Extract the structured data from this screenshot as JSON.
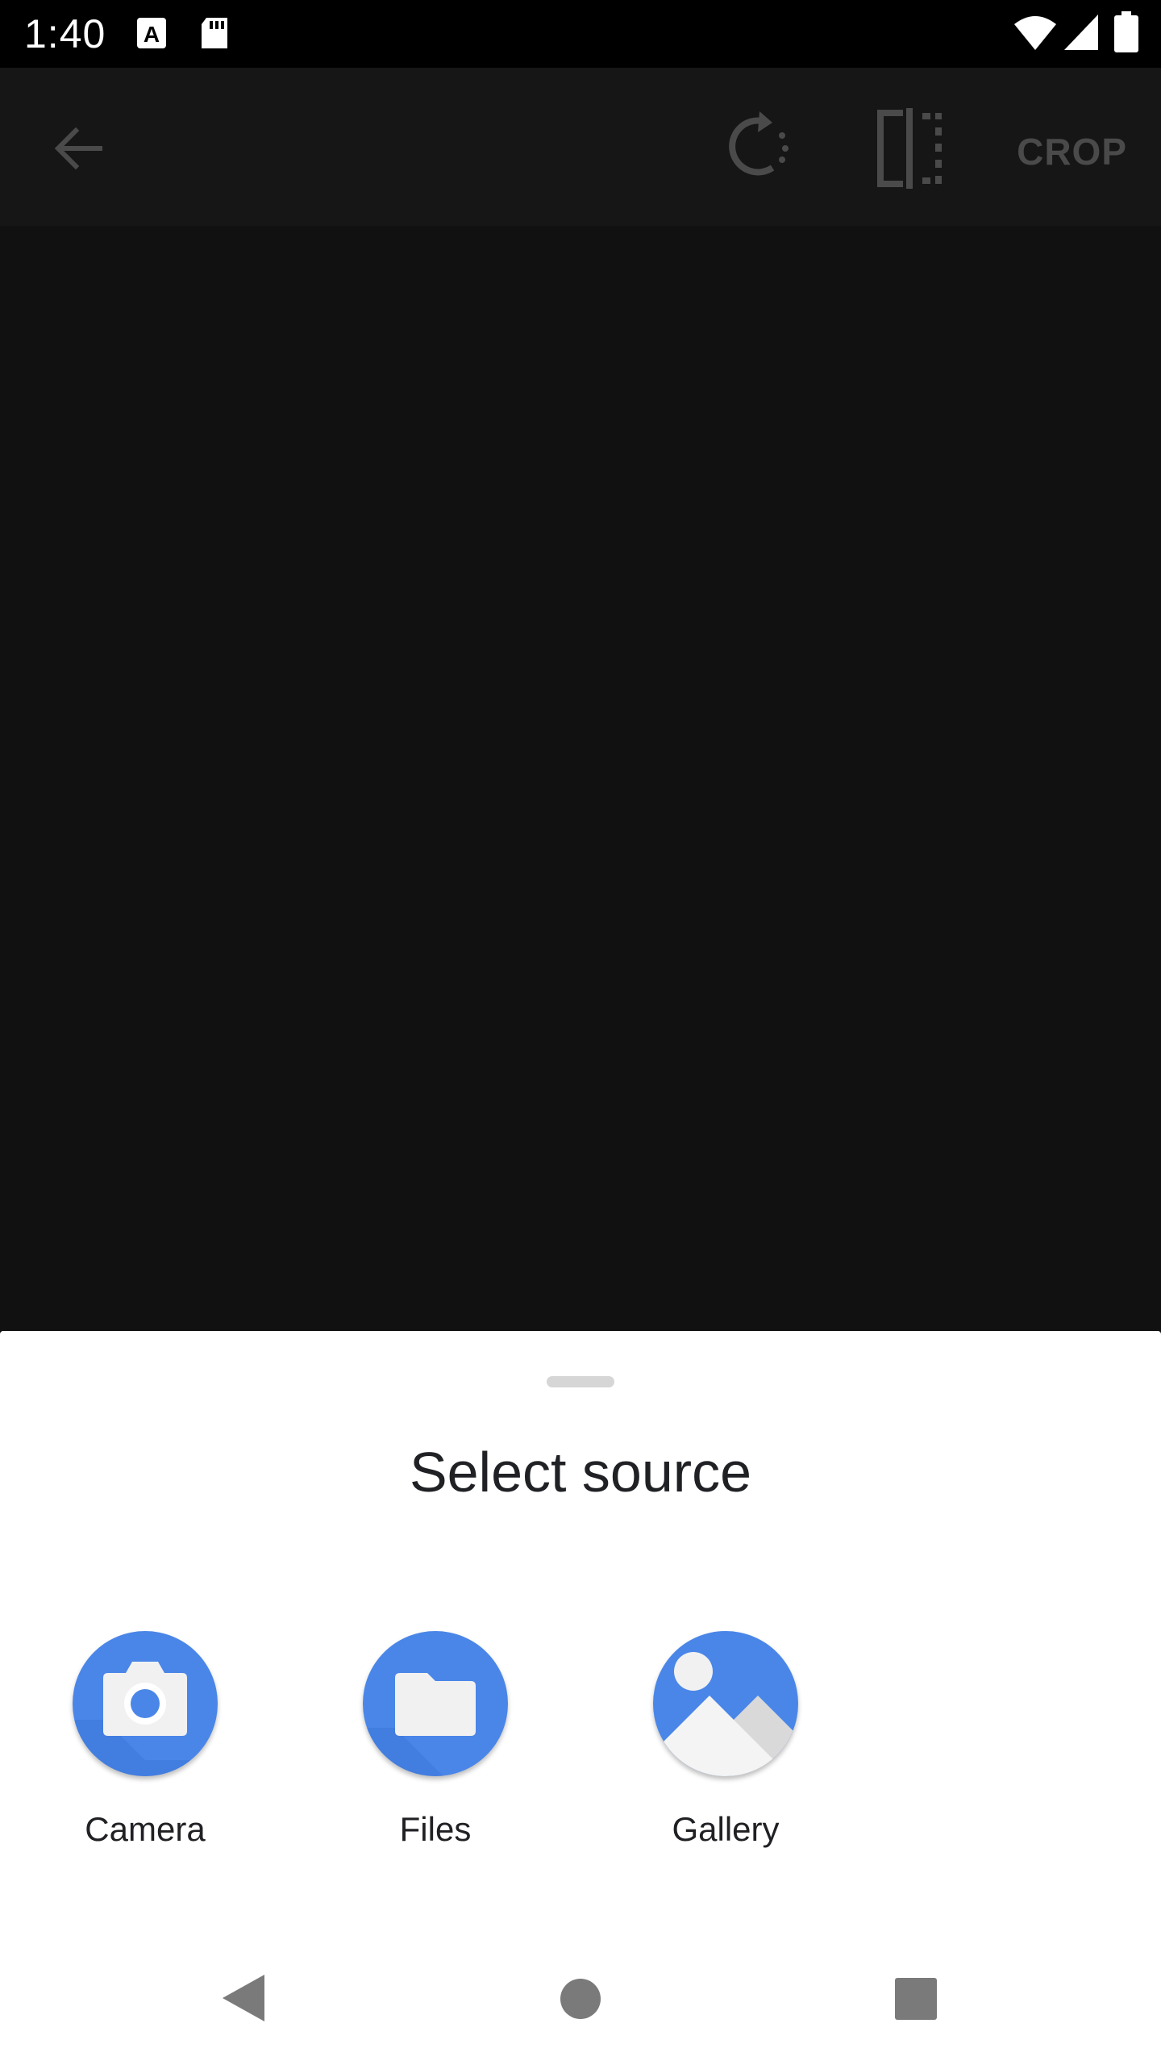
{
  "status_bar": {
    "time": "1:40",
    "icons": [
      "a-notification-icon",
      "sd-card-icon",
      "wifi-icon",
      "cell-signal-icon",
      "battery-icon"
    ]
  },
  "app_bar": {
    "back_icon": "arrow-back-icon",
    "rotate_icon": "rotate-icon",
    "flip_icon": "flip-icon",
    "crop_label": "CROP"
  },
  "sheet": {
    "title": "Select source",
    "sources": [
      {
        "label": "Camera",
        "icon": "camera-icon"
      },
      {
        "label": "Files",
        "icon": "folder-icon"
      },
      {
        "label": "Gallery",
        "icon": "gallery-icon"
      }
    ]
  },
  "nav_bar": {
    "icons": [
      "nav-back-icon",
      "nav-home-icon",
      "nav-recents-icon"
    ]
  },
  "colors": {
    "accent": "#4a86e8",
    "scrim_dark": "#111111",
    "sheet_bg": "#ffffff"
  }
}
